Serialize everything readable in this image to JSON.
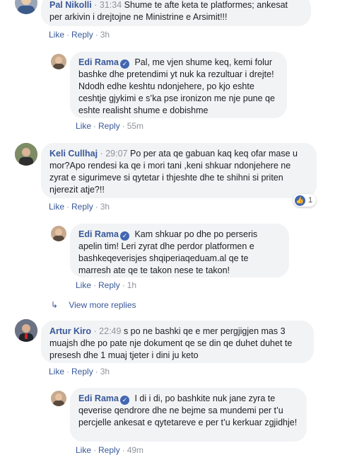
{
  "actions": {
    "like": "Like",
    "reply": "Reply",
    "sep": "·"
  },
  "comments": [
    {
      "author": "Pal Nikolli",
      "time": "31:34",
      "text": "Shume te afte keta te platformes; ankesat per arkivin i drejtojne ne Ministrine e Arsimit!!!",
      "age": "3h"
    },
    {
      "author": "Edi Rama",
      "text": "Pal, me vjen shume keq, kemi folur bashke dhe pretendimi yt nuk ka rezultuar i drejte! Ndodh edhe keshtu ndonjehere, po kjo eshte ceshtje gjykimi e s’ka pse ironizon me nje pune qe eshte realisht shume e dobishme",
      "age": "55m"
    },
    {
      "author": "Keli Cullhaj",
      "time": "29:07",
      "text": "Po per ata qe gabuan kaq keq ofar mase u mor?Apo rendesi ka qe i mori tani ,keni shkuar ndonjehere ne zyrat e sigurimeve si qytetar i thjeshte dhe te shihni si priten njerezit atje?!!",
      "age": "3h",
      "reactions": "1"
    },
    {
      "author": "Edi Rama",
      "text": "Kam shkuar po dhe po perseris apelin tim! Leri zyrat dhe perdor platformen e bashkeqeverisjes shqiperiaqeduam.al qe te marresh ate qe te takon nese te takon!",
      "age": "1h"
    },
    {
      "author": "Artur Kiro",
      "time": "22:49",
      "text": "s po ne bashki qe e mer pergjigjen mas 3 muajsh dhe po pate nje dokument qe se din qe duhet duhet te presesh dhe 1 muaj tjeter i dini ju keto",
      "age": "3h"
    },
    {
      "author": "Edi Rama",
      "text": "I di i di, po bashkite nuk jane zyra te qeverise qendrore dhe ne bejme sa mundemi per t’u percjelle ankesat e qytetareve e per t’u kerkuar zgjidhje!",
      "age": "49m"
    }
  ],
  "view_more": "View more replies",
  "colors": {
    "link": "#385898",
    "bubble": "#f2f3f5",
    "verified": "#4267b2"
  }
}
